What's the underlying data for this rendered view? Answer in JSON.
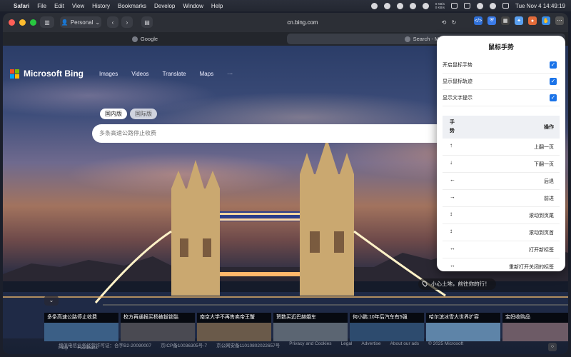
{
  "menubar": {
    "app": "Safari",
    "items": [
      "File",
      "Edit",
      "View",
      "History",
      "Bookmarks",
      "Develop",
      "Window",
      "Help"
    ],
    "netstat": {
      "up": "0 KB/s",
      "down": "0 KB/s"
    },
    "datetime": "Tue Nov 4  14:49:19"
  },
  "toolbar": {
    "profile": "Personal",
    "url": "cn.bing.com"
  },
  "tabs": [
    {
      "label": "Google"
    },
    {
      "label": "Search - Micro"
    }
  ],
  "bing": {
    "logo_text": "Microsoft Bing",
    "nav": [
      "Images",
      "Videos",
      "Translate",
      "Maps",
      "···"
    ],
    "region_tabs": [
      "国内版",
      "国际版"
    ],
    "search_placeholder": "多条高速公路停止收费",
    "location": "小心土地，前往你的行！",
    "collapse_glyph": "⌄"
  },
  "news": [
    "多条高速公路停止收费",
    "校方再通报买杨被拔锁骷",
    "南京大学不再售卖帝王蟹",
    "贺数买迈巴赫婚车",
    "何小鹏:10年后汽车有5强",
    "哈尔滨冰雪大世界扩容",
    "宝妈收购品"
  ],
  "footer": {
    "row1": [
      "增值电信业务经营许可证：合字B2-20090007",
      "京ICP备10036305号-7",
      "京公网安备11010802022657号",
      "Privacy and Cookies",
      "Legal",
      "Advertise",
      "About our ads",
      "© 2025 Microsoft"
    ],
    "row2": [
      "Help",
      "Feedback"
    ]
  },
  "popup": {
    "title": "鼠标手势",
    "options": [
      {
        "label": "开启鼠标手势",
        "checked": true
      },
      {
        "label": "显示鼠标轨迹",
        "checked": true
      },
      {
        "label": "显示文字提示",
        "checked": true
      }
    ],
    "table_head": {
      "gesture": "手势",
      "action": "操作"
    },
    "gestures": [
      {
        "glyph": "↑",
        "action": "上翻一页"
      },
      {
        "glyph": "↓",
        "action": "下翻一页"
      },
      {
        "glyph": "←",
        "action": "后退"
      },
      {
        "glyph": "→",
        "action": "前进"
      },
      {
        "glyph": "↕",
        "action": "滚动到页尾"
      },
      {
        "glyph": "↕",
        "action": "滚动到页首"
      },
      {
        "glyph": "↔",
        "action": "打开新标签"
      },
      {
        "glyph": "↔",
        "action": "重新打开关闭的标签"
      }
    ]
  },
  "colors": {
    "accent": "#1a73e8",
    "close": "#ff5f57",
    "minimize": "#febc2e",
    "zoom": "#28c840"
  }
}
